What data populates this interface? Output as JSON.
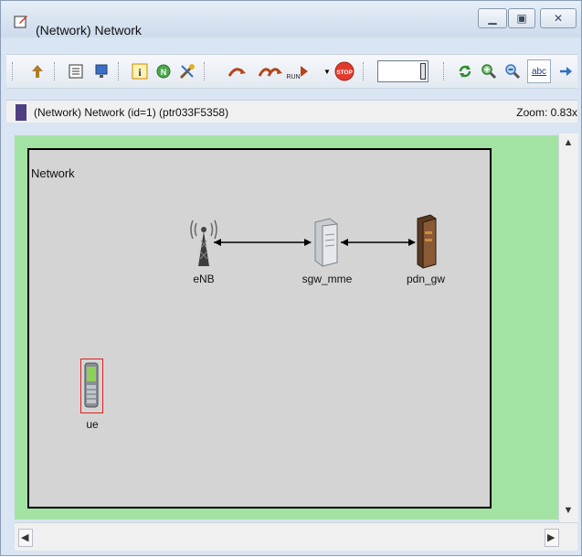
{
  "window": {
    "title": "(Network) Network",
    "title_icon": "edit-pencil-icon",
    "controls": [
      "minimize-icon",
      "maximize-icon",
      "close-icon"
    ]
  },
  "toolbar": {
    "buttons": [
      "go-to-parent-icon",
      "list-icon",
      "monitor-icon",
      "info-icon",
      "network-icon",
      "tools-icon",
      "step-icon",
      "fast-run-icon",
      "run-icon",
      "stop-icon",
      "refresh-icon",
      "zoom-in-icon",
      "zoom-out-icon",
      "text-labels-icon",
      "next-icon"
    ],
    "run_label": "RUN",
    "stop_label": "STOP",
    "text_button_label": "abc"
  },
  "status": {
    "path": "(Network) Network  (id=1)  (ptr033F5358)",
    "zoom": "Zoom: 0.83x"
  },
  "network": {
    "label": "Network",
    "nodes": [
      {
        "id": "eNB",
        "label": "eNB",
        "icon": "antenna-icon"
      },
      {
        "id": "sgw_mme",
        "label": "sgw_mme",
        "icon": "server-icon"
      },
      {
        "id": "pdn_gw",
        "label": "pdn_gw",
        "icon": "gateway-tower-icon"
      },
      {
        "id": "ue",
        "label": "ue",
        "icon": "mobile-phone-icon"
      }
    ],
    "links": [
      [
        "eNB",
        "sgw_mme"
      ],
      [
        "sgw_mme",
        "pdn_gw"
      ]
    ]
  },
  "colors": {
    "canvas_background": "#a2e2a2",
    "network_background": "#d4d4d4",
    "selection_border": "#e02020"
  }
}
